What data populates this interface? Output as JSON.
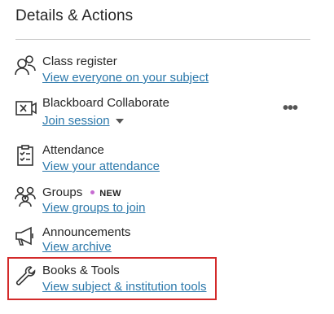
{
  "panel": {
    "title": "Details & Actions"
  },
  "items": [
    {
      "icon": "class-register-icon",
      "label": "Class register",
      "link": "View everyone on your subject"
    },
    {
      "icon": "collaborate-icon",
      "label": "Blackboard Collaborate",
      "link": "Join session",
      "more": "•••"
    },
    {
      "icon": "attendance-icon",
      "label": "Attendance",
      "link": "View your attendance"
    },
    {
      "icon": "groups-icon",
      "label": "Groups",
      "badge": "NEW",
      "link": "View groups to join"
    },
    {
      "icon": "announcements-icon",
      "label": "Announcements",
      "link": "View archive"
    },
    {
      "icon": "wrench-icon",
      "label": "Books & Tools",
      "link": "View subject & institution tools"
    }
  ],
  "colors": {
    "link": "#2b78ab",
    "highlight": "#d32a2a",
    "badge_dot": "#c66bd1"
  }
}
